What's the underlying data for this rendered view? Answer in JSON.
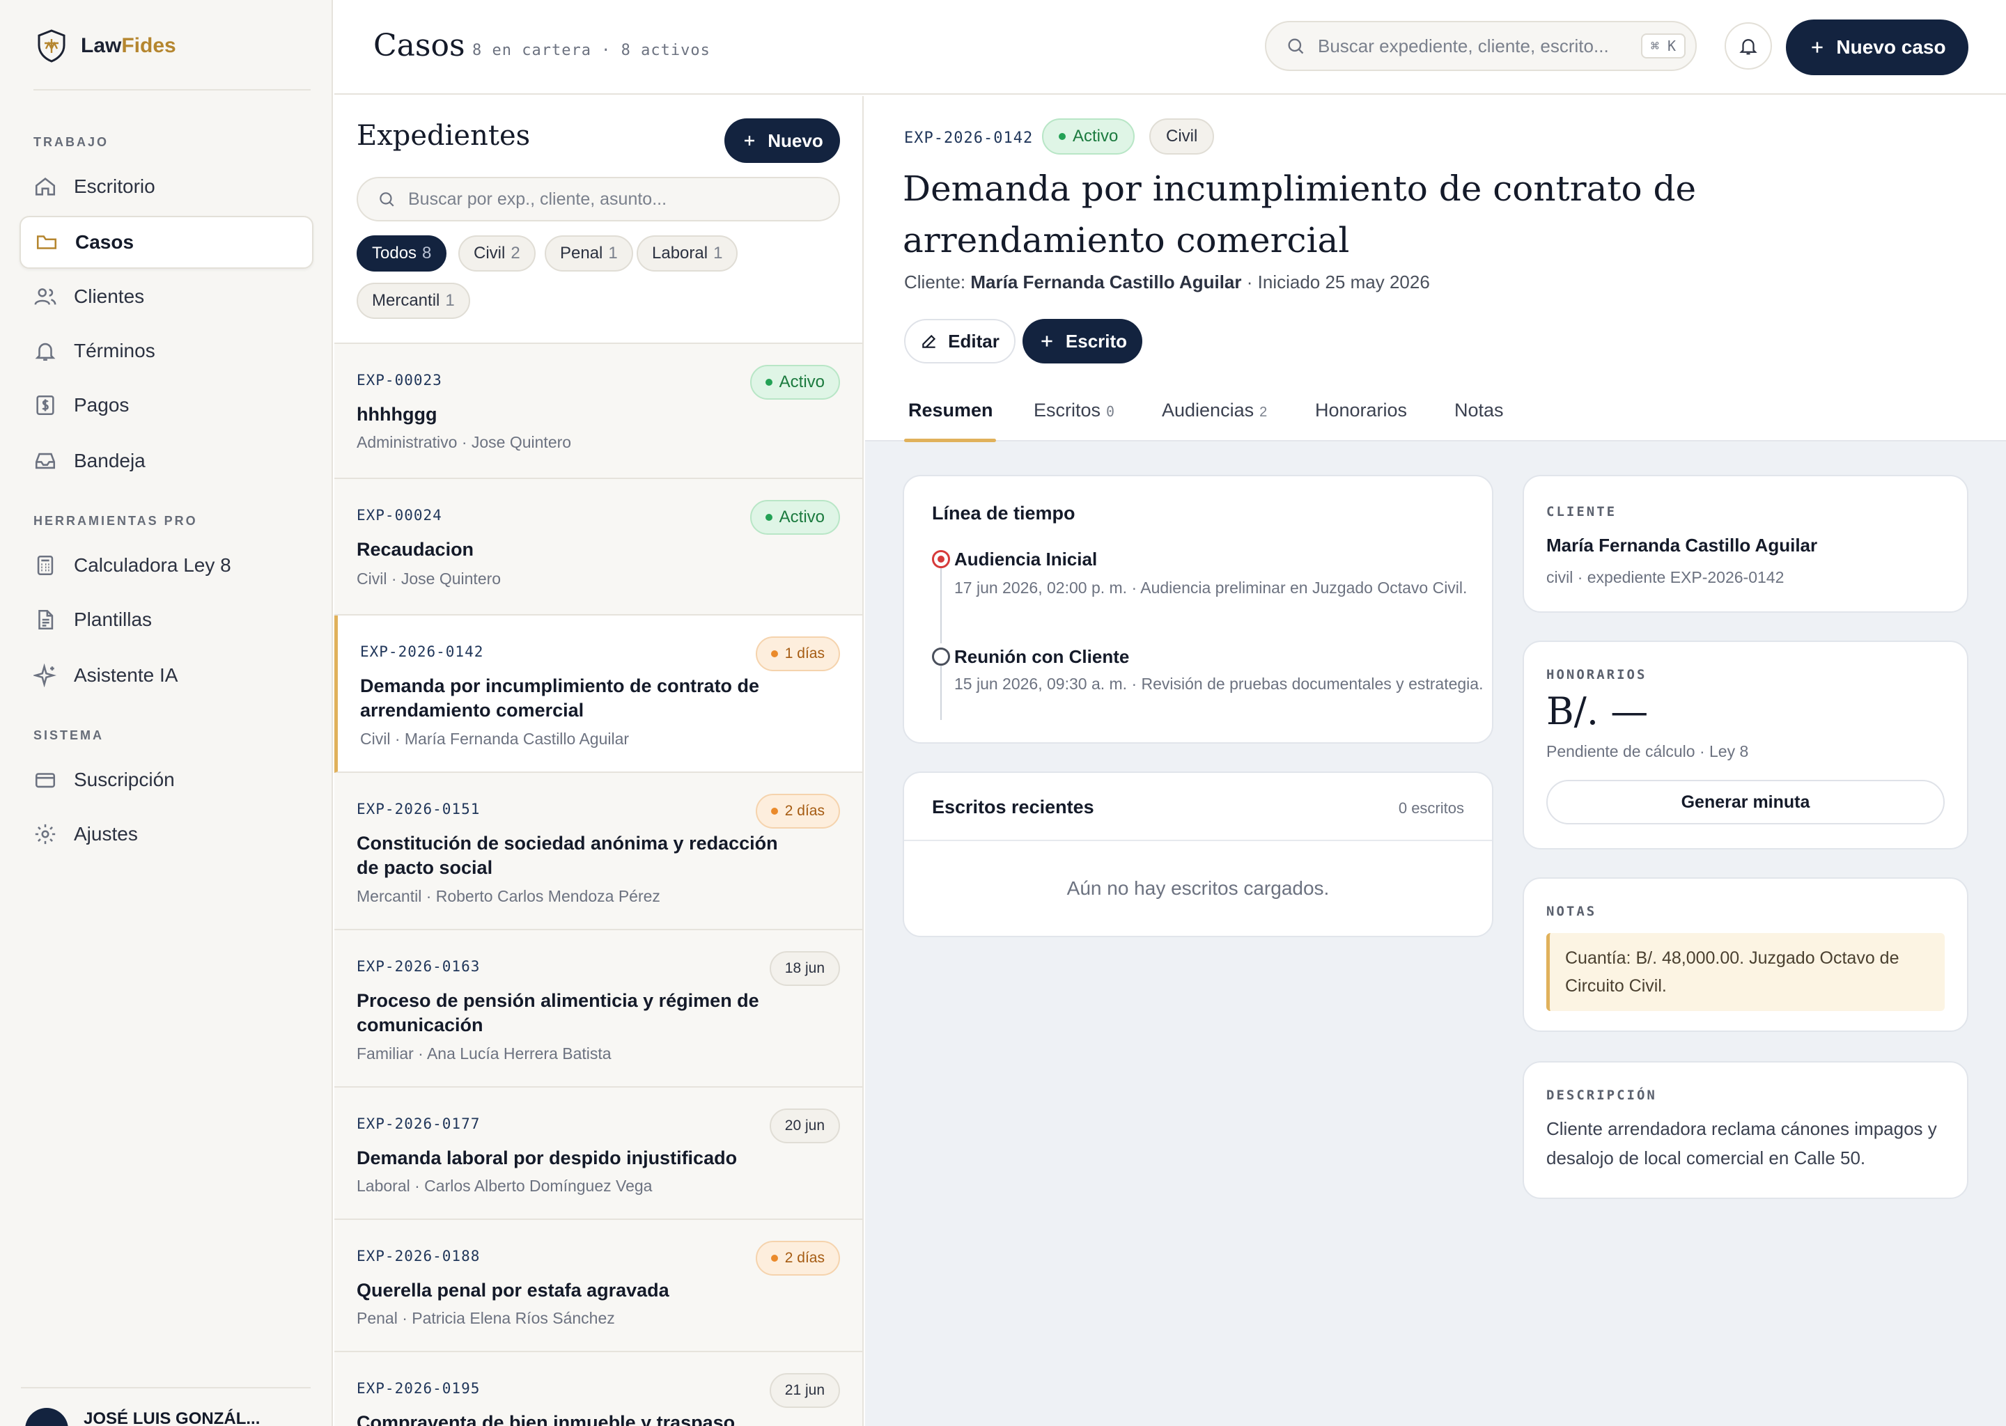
{
  "app": {
    "brand_main": "Law",
    "brand_accent": "Fides"
  },
  "sidebar": {
    "sections": [
      "TRABAJO",
      "HERRAMIENTAS PRO",
      "SISTEMA"
    ],
    "items": [
      {
        "label": "Escritorio",
        "icon": "home-icon"
      },
      {
        "label": "Casos",
        "icon": "folder-icon",
        "active": true
      },
      {
        "label": "Clientes",
        "icon": "users-icon"
      },
      {
        "label": "Términos",
        "icon": "bell-icon"
      },
      {
        "label": "Pagos",
        "icon": "dollar-icon"
      },
      {
        "label": "Bandeja",
        "icon": "inbox-icon"
      },
      {
        "label": "Calculadora Ley 8",
        "icon": "calculator-icon"
      },
      {
        "label": "Plantillas",
        "icon": "document-icon"
      },
      {
        "label": "Asistente IA",
        "icon": "sparkle-icon"
      },
      {
        "label": "Suscripción",
        "icon": "card-icon"
      },
      {
        "label": "Ajustes",
        "icon": "gear-icon"
      }
    ],
    "user_name": "JOSÉ LUIS GONZÁL..."
  },
  "topbar": {
    "title": "Casos",
    "subtitle": "8 en cartera · 8 activos",
    "search_placeholder": "Buscar expediente, cliente, escrito...",
    "shortcut": "⌘ K",
    "new_case_label": "Nuevo caso"
  },
  "list": {
    "title": "Expedientes",
    "new_label": "Nuevo",
    "search_placeholder": "Buscar por exp., cliente, asunto...",
    "filters": [
      {
        "label": "Todos",
        "count": "8",
        "active": true
      },
      {
        "label": "Civil",
        "count": "2"
      },
      {
        "label": "Penal",
        "count": "1"
      },
      {
        "label": "Laboral",
        "count": "1"
      },
      {
        "label": "Mercantil",
        "count": "1"
      }
    ],
    "cases": [
      {
        "id": "EXP-00023",
        "title": "hhhhggg",
        "meta": "Administrativo · Jose Quintero",
        "badge": "Activo",
        "badge_type": "green"
      },
      {
        "id": "EXP-00024",
        "title": "Recaudacion",
        "meta": "Civil · Jose Quintero",
        "badge": "Activo",
        "badge_type": "green"
      },
      {
        "id": "EXP-2026-0142",
        "title": "Demanda por incumplimiento de contrato de arrendamiento comercial",
        "meta": "Civil · María Fernanda Castillo Aguilar",
        "badge": "1 días",
        "badge_type": "orange",
        "selected": true
      },
      {
        "id": "EXP-2026-0151",
        "title": "Constitución de sociedad anónima y redacción de pacto social",
        "meta": "Mercantil · Roberto Carlos Mendoza Pérez",
        "badge": "2 días",
        "badge_type": "orange"
      },
      {
        "id": "EXP-2026-0163",
        "title": "Proceso de pensión alimenticia y régimen de comunicación",
        "meta": "Familiar · Ana Lucía Herrera Batista",
        "badge": "18 jun",
        "badge_type": "gray"
      },
      {
        "id": "EXP-2026-0177",
        "title": "Demanda laboral por despido injustificado",
        "meta": "Laboral · Carlos Alberto Domínguez Vega",
        "badge": "20 jun",
        "badge_type": "gray"
      },
      {
        "id": "EXP-2026-0188",
        "title": "Querella penal por estafa agravada",
        "meta": "Penal · Patricia Elena Ríos Sánchez",
        "badge": "2 días",
        "badge_type": "orange"
      },
      {
        "id": "EXP-2026-0195",
        "title": "Compraventa de bien inmueble y traspaso registral",
        "meta": "",
        "badge": "21 jun",
        "badge_type": "gray"
      }
    ]
  },
  "detail": {
    "id": "EXP-2026-0142",
    "status": "Activo",
    "area": "Civil",
    "title": "Demanda por incumplimiento de contrato de arrendamiento comercial",
    "client_label": "Cliente:",
    "client_name": "María Fernanda Castillo Aguilar",
    "started": "· Iniciado 25 may 2026",
    "edit_label": "Editar",
    "escrito_label": "Escrito",
    "tabs": [
      {
        "label": "Resumen",
        "count": ""
      },
      {
        "label": "Escritos",
        "count": "0"
      },
      {
        "label": "Audiencias",
        "count": "2"
      },
      {
        "label": "Honorarios",
        "count": ""
      },
      {
        "label": "Notas",
        "count": ""
      }
    ],
    "timeline": {
      "title": "Línea de tiempo",
      "events": [
        {
          "title": "Audiencia Inicial",
          "desc": "17 jun 2026, 02:00 p. m. · Audiencia preliminar en Juzgado Octavo Civil."
        },
        {
          "title": "Reunión con Cliente",
          "desc": "15 jun 2026, 09:30 a. m. · Revisión de pruebas documentales y estrategia."
        }
      ]
    },
    "escritos": {
      "title": "Escritos recientes",
      "count_label": "0 escritos",
      "empty": "Aún no hay escritos cargados."
    },
    "client_card": {
      "label": "CLIENTE",
      "name": "María Fernanda Castillo Aguilar",
      "meta": "civil · expediente EXP-2026-0142"
    },
    "fees_card": {
      "label": "HONORARIOS",
      "amount": "B/. —",
      "meta": "Pendiente de cálculo · Ley 8",
      "button": "Generar minuta"
    },
    "notes_card": {
      "label": "NOTAS",
      "text": "Cuantía: B/. 48,000.00. Juzgado Octavo de Circuito Civil."
    },
    "desc_card": {
      "label": "DESCRIPCIÓN",
      "text": "Cliente arrendadora reclama cánones impagos y desalojo de local comercial en Calle 50."
    }
  },
  "colors": {
    "navy": "#13233f",
    "gold": "#b5862f",
    "active_green": "#23a155",
    "warn_orange": "#ea8a2b",
    "timeline_red": "#d63a3a"
  }
}
